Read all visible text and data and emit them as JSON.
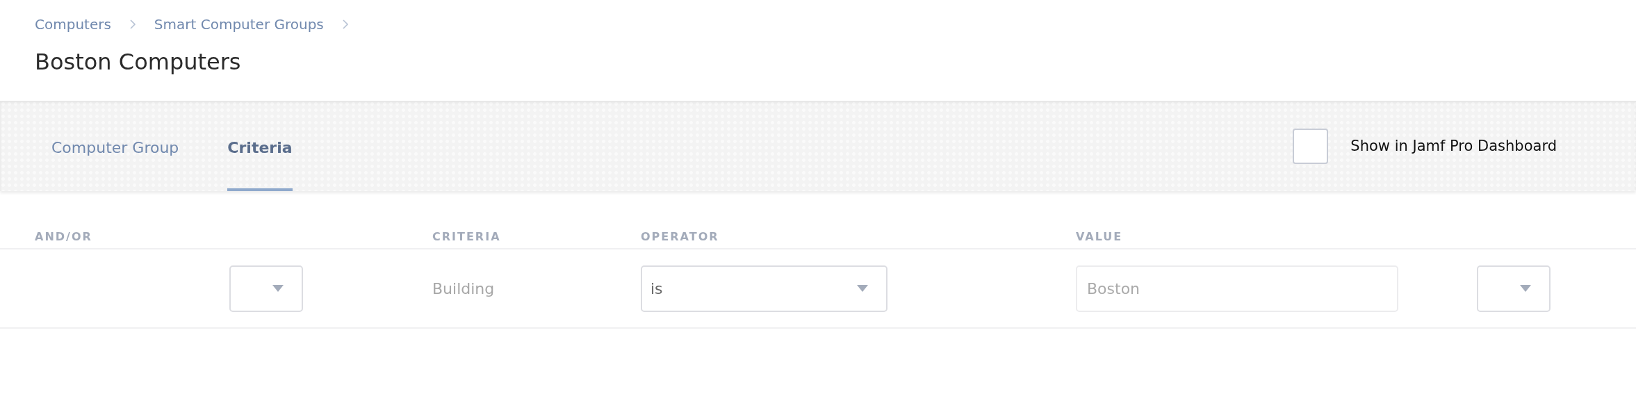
{
  "breadcrumbs": [
    {
      "label": "Computers"
    },
    {
      "label": "Smart Computer Groups"
    }
  ],
  "title": "Boston Computers",
  "tabs": [
    {
      "label": "Computer Group",
      "selected": false
    },
    {
      "label": "Criteria",
      "selected": true
    }
  ],
  "dashboard_checkbox": {
    "label": "Show in Jamf Pro Dashboard",
    "checked": false
  },
  "table": {
    "columns": [
      "AND/OR",
      "CRITERIA",
      "OPERATOR",
      "VALUE"
    ],
    "rows": [
      {
        "criteria": "Building",
        "operator": "is",
        "value_placeholder": "Boston"
      }
    ]
  }
}
